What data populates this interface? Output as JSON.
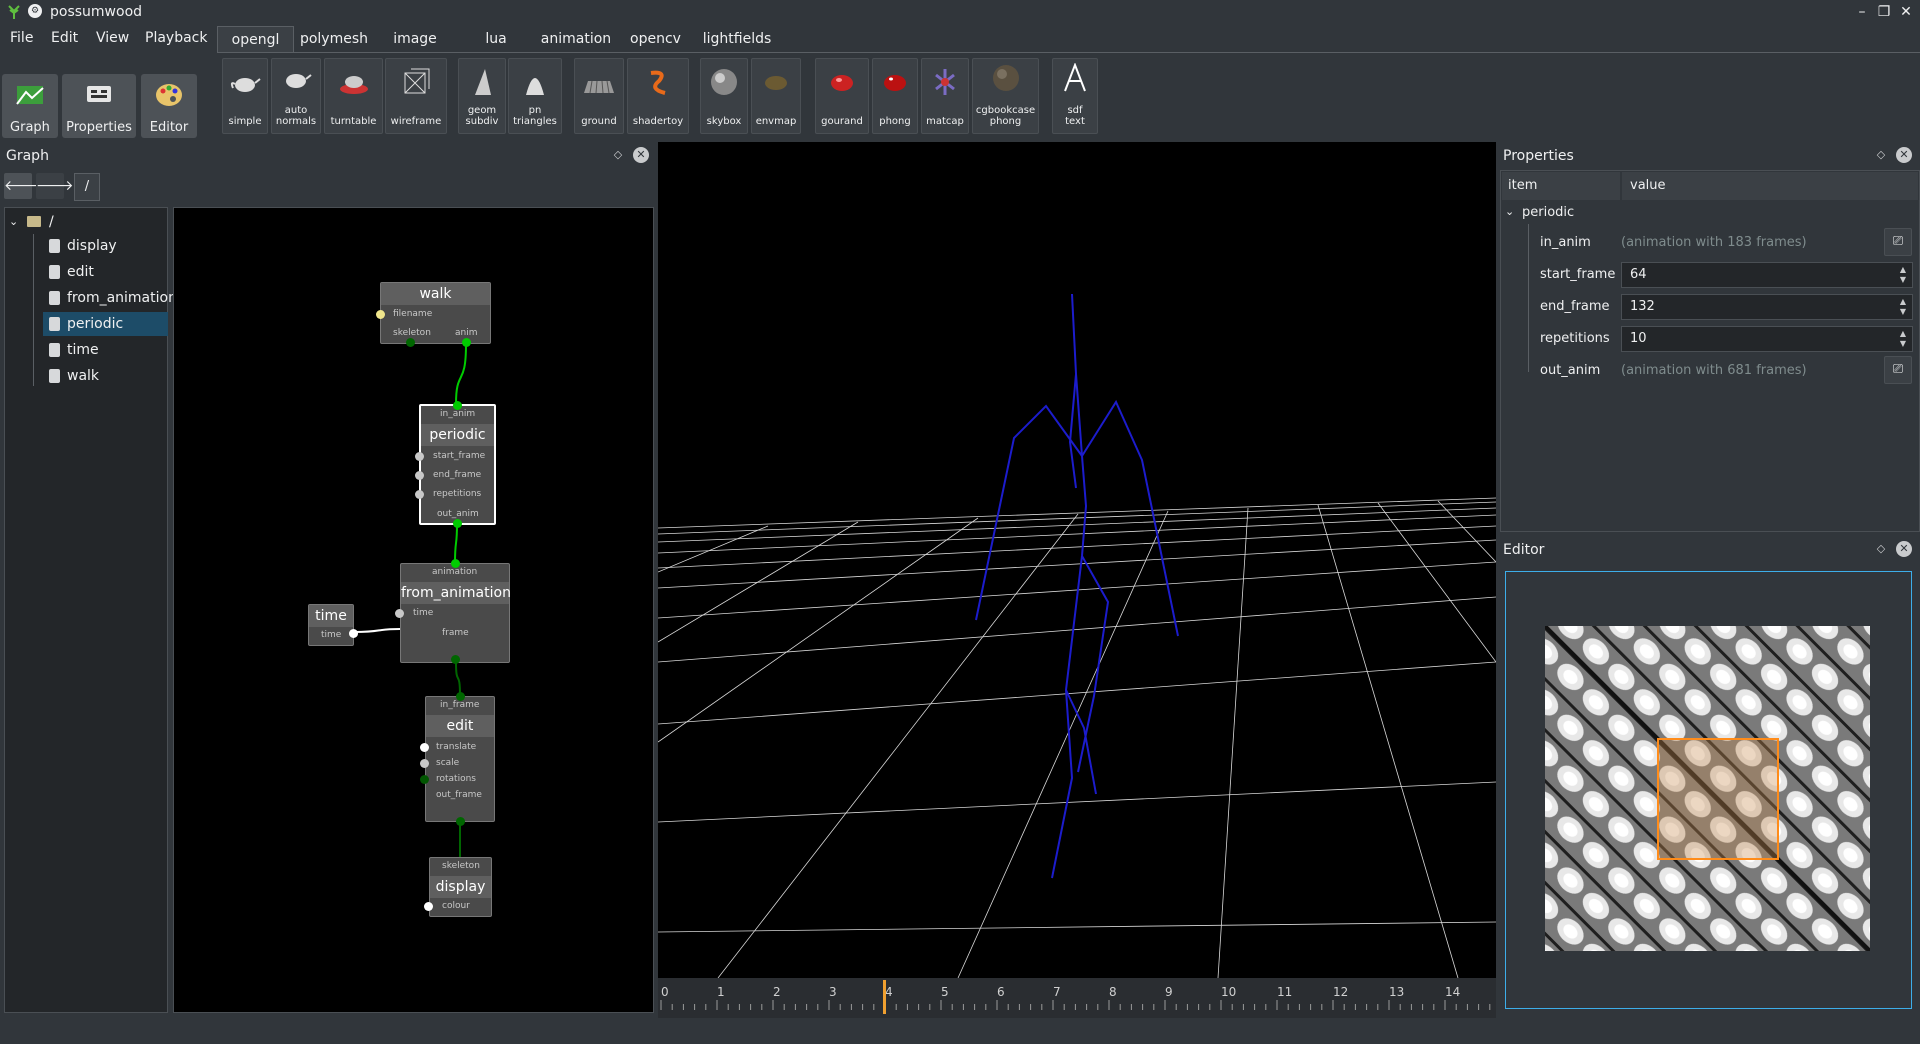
{
  "window": {
    "title": "possumwood",
    "minimize": "–",
    "maximize": "❐",
    "close": "✕"
  },
  "menu": [
    "File",
    "Edit",
    "View",
    "Playback"
  ],
  "modes": [
    {
      "label": "Graph",
      "icon": "graph-icon"
    },
    {
      "label": "Properties",
      "icon": "properties-icon"
    },
    {
      "label": "Editor",
      "icon": "editor-icon"
    }
  ],
  "tabs": [
    "opengl",
    "polymesh",
    "image",
    "lua",
    "animation",
    "opencv",
    "lightfields"
  ],
  "active_tab": "opengl",
  "toolbar": [
    {
      "label": "simple",
      "icon": "teapot-icon"
    },
    {
      "label": "auto\nnormals",
      "icon": "teapot-normals-icon"
    },
    {
      "label": "turntable",
      "icon": "turntable-icon"
    },
    {
      "label": "wireframe",
      "icon": "wireframe-icon"
    },
    {
      "label": "geom\nsubdiv",
      "icon": "geom-subdiv-icon"
    },
    {
      "label": "pn\ntriangles",
      "icon": "pn-triangles-icon"
    },
    {
      "label": "ground",
      "icon": "ground-icon"
    },
    {
      "label": "shadertoy",
      "icon": "shadertoy-icon"
    },
    {
      "label": "skybox",
      "icon": "skybox-icon"
    },
    {
      "label": "envmap",
      "icon": "envmap-icon"
    },
    {
      "label": "gourand",
      "icon": "gourand-icon"
    },
    {
      "label": "phong",
      "icon": "phong-icon"
    },
    {
      "label": "matcap",
      "icon": "matcap-icon"
    },
    {
      "label": "cgbookcase\nphong",
      "icon": "cgbookcase-icon"
    },
    {
      "label": "sdf\ntext",
      "icon": "sdf-text-icon"
    }
  ],
  "graph_panel": {
    "title": "Graph",
    "float": "◇",
    "close": "✕",
    "back": "🡐",
    "forward": "🡒",
    "path": "/",
    "tree": {
      "root": "/",
      "items": [
        "display",
        "edit",
        "from_animation",
        "periodic",
        "time",
        "walk"
      ],
      "selected": "periodic"
    },
    "nodes": {
      "walk": {
        "title": "walk",
        "ports": [
          "filename",
          "skeleton",
          "anim"
        ]
      },
      "periodic": {
        "title": "periodic",
        "ports": [
          "in_anim",
          "start_frame",
          "end_frame",
          "repetitions",
          "out_anim"
        ]
      },
      "time": {
        "title": "time",
        "ports": [
          "time"
        ]
      },
      "from_animation": {
        "title": "from_animation",
        "ports": [
          "animation",
          "time",
          "frame"
        ]
      },
      "edit": {
        "title": "edit",
        "ports": [
          "in_frame",
          "translate",
          "scale",
          "rotations",
          "out_frame"
        ]
      },
      "display": {
        "title": "display",
        "ports": [
          "skeleton",
          "colour"
        ]
      }
    }
  },
  "viewport": {
    "timeline": {
      "ticks": [
        "0",
        "1",
        "2",
        "3",
        "4",
        "5",
        "6",
        "7",
        "8",
        "9",
        "10",
        "11",
        "12",
        "13",
        "14"
      ],
      "current": 4,
      "marker_color": "#f0a030"
    }
  },
  "properties_panel": {
    "title": "Properties",
    "float": "◇",
    "close": "✕",
    "columns": [
      "item",
      "value"
    ],
    "group": "periodic",
    "rows": [
      {
        "name": "in_anim",
        "value": "(animation with 183 frames)",
        "kind": "readonly"
      },
      {
        "name": "start_frame",
        "value": "64",
        "kind": "spin"
      },
      {
        "name": "end_frame",
        "value": "132",
        "kind": "spin"
      },
      {
        "name": "repetitions",
        "value": "10",
        "kind": "spin"
      },
      {
        "name": "out_anim",
        "value": "(animation with 681 frames)",
        "kind": "readonly"
      }
    ]
  },
  "editor_panel": {
    "title": "Editor",
    "float": "◇",
    "close": "✕"
  },
  "colors": {
    "accent": "#3daee9",
    "selection": "#1d4c68",
    "skeleton": "#1c1ccc",
    "grid": "#ffffff",
    "connection": "#00cc00"
  }
}
